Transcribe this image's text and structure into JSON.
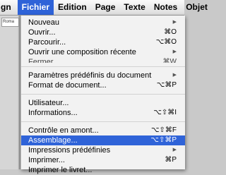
{
  "menubar": {
    "items": [
      {
        "label": "gn"
      },
      {
        "label": "Fichier"
      },
      {
        "label": "Edition"
      },
      {
        "label": "Page"
      },
      {
        "label": "Texte"
      },
      {
        "label": "Notes"
      },
      {
        "label": "Objet"
      }
    ]
  },
  "background": {
    "font_field": "Roma"
  },
  "menu": {
    "items": [
      {
        "label": "Nouveau",
        "shortcut": "",
        "submenu": "▶"
      },
      {
        "label": "Ouvrir...",
        "shortcut": "⌘O"
      },
      {
        "label": "Parcourir...",
        "shortcut": "⌥⌘O"
      },
      {
        "label": "Ouvrir une composition récente",
        "submenu": "▶"
      },
      {
        "label": "Fermer",
        "shortcut": "⌘W"
      },
      {
        "label": "Paramètres prédéfinis du document",
        "submenu": "▶"
      },
      {
        "label": "Format de document...",
        "shortcut": "⌥⌘P"
      },
      {
        "label": "Utilisateur..."
      },
      {
        "label": "Informations...",
        "shortcut": "⌥⇧⌘I"
      },
      {
        "label": "Contrôle en amont...",
        "shortcut": "⌥⇧⌘F"
      },
      {
        "label": "Assemblage...",
        "shortcut": "⌥⇧⌘P"
      },
      {
        "label": "Impressions prédéfinies",
        "submenu": "▶"
      },
      {
        "label": "Imprimer...",
        "shortcut": "⌘P"
      },
      {
        "label": "Imprimer le livret..."
      }
    ]
  },
  "colors": {
    "highlight": "#2f63d8"
  }
}
